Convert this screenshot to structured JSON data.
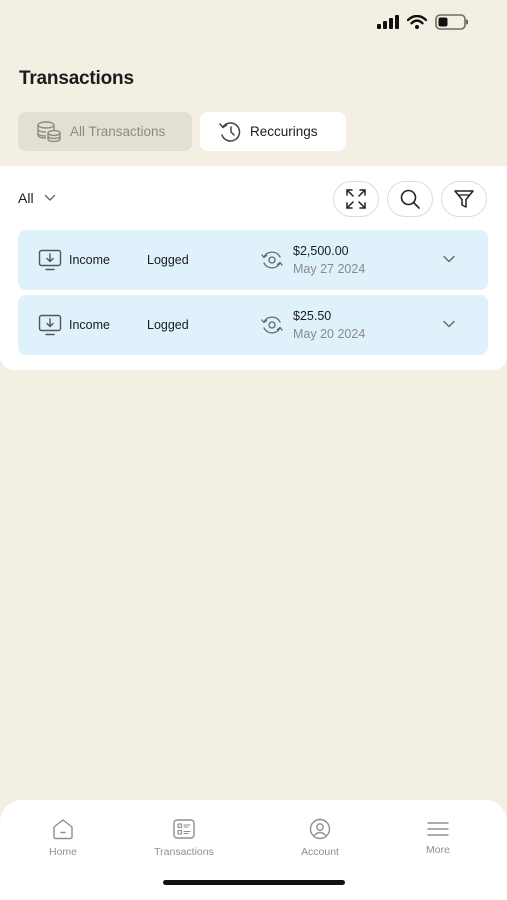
{
  "page": {
    "title": "Transactions"
  },
  "tabs": [
    {
      "label": "All Transactions",
      "icon": "stack-coins-icon",
      "active": false
    },
    {
      "label": "Reccurings",
      "icon": "history-icon",
      "active": true
    }
  ],
  "filter": {
    "selected": "All",
    "buttons": [
      "expand-icon",
      "search-icon",
      "filter-icon"
    ]
  },
  "transactions": [
    {
      "type": "Income",
      "status": "Logged",
      "amount": "$2,500.00",
      "date": "May 27 2024"
    },
    {
      "type": "Income",
      "status": "Logged",
      "amount": "$25.50",
      "date": "May 20 2024"
    }
  ],
  "nav": [
    {
      "label": "Home",
      "icon": "home-icon"
    },
    {
      "label": "Transactions",
      "icon": "transactions-icon"
    },
    {
      "label": "Account",
      "icon": "account-icon"
    },
    {
      "label": "More",
      "icon": "menu-icon"
    }
  ],
  "colors": {
    "background": "#f3efe3",
    "card": "#dff1fb",
    "inactive_tab": "#e3dfd2"
  }
}
